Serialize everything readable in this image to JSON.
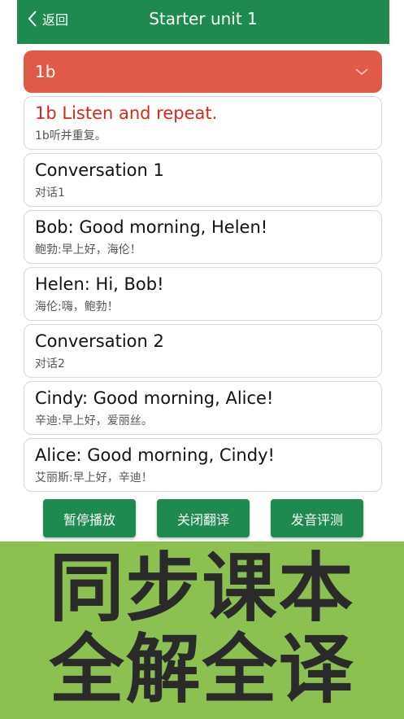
{
  "header": {
    "back_label": "返回",
    "title": "Starter unit 1"
  },
  "dropdown": {
    "value": "1b"
  },
  "items": [
    {
      "en": "1b Listen and repeat.",
      "cn": "1b听并重复。"
    },
    {
      "en": "Conversation 1",
      "cn": "对话1"
    },
    {
      "en": "Bob: Good morning, Helen!",
      "cn": "鲍勃:早上好，海伦！"
    },
    {
      "en": "Helen: Hi, Bob!",
      "cn": "海伦:嗨，鲍勃！"
    },
    {
      "en": "Conversation 2",
      "cn": "对话2"
    },
    {
      "en": "Cindy: Good morning, Alice!",
      "cn": "辛迪:早上好，爱丽丝。"
    },
    {
      "en": "Alice: Good morning, Cindy!",
      "cn": "艾丽斯:早上好，辛迪！"
    }
  ],
  "buttons": {
    "pause": "暂停播放",
    "close_translation": "关闭翻译",
    "pronunciation": "发音评测"
  },
  "banner": {
    "line1": "同步课本",
    "line2": "全解全译"
  },
  "colors": {
    "header": "#1f8a4f",
    "dropdown": "#e05a48",
    "highlight_text": "#d42a1c",
    "banner": "#8cc152"
  }
}
